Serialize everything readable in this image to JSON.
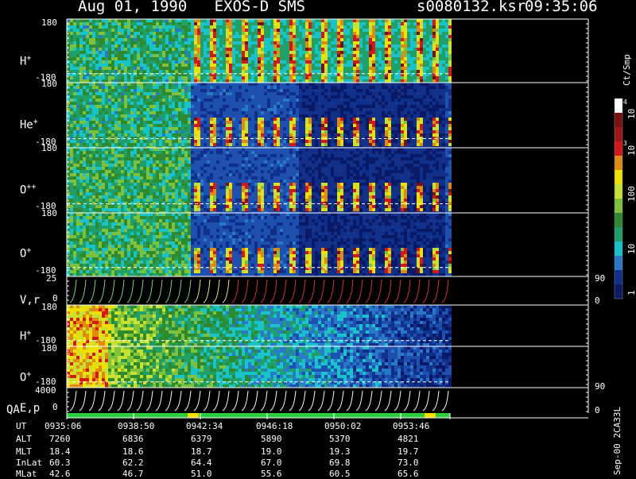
{
  "header": {
    "title": "Aug 01, 1990   EXOS-D SMS",
    "file": "s0080132.ksr",
    "time": "09:35:06"
  },
  "colorbar": {
    "unit": "Ct/Smp",
    "ticks": [
      "10",
      "10",
      "10",
      "100",
      "10",
      "1"
    ],
    "exponents": [
      "4",
      "3"
    ]
  },
  "footer_left": "Sep-00 2CA33L",
  "chart_data": {
    "type": "heatmap",
    "time_axis": {
      "label": "UT",
      "ticks": [
        "0935:06",
        "0938:50",
        "0942:34",
        "0946:18",
        "0950:02",
        "0953:46"
      ]
    },
    "ephemeris": [
      {
        "label": "ALT",
        "values": [
          "7260",
          "6836",
          "6379",
          "5890",
          "5370",
          "4821"
        ]
      },
      {
        "label": "MLT",
        "values": [
          "18.4",
          "18.6",
          "18.7",
          "19.0",
          "19.3",
          "19.7"
        ]
      },
      {
        "label": "InLat",
        "values": [
          "60.3",
          "62.2",
          "64.4",
          "67.0",
          "69.8",
          "73.0"
        ]
      },
      {
        "label": "MLat",
        "values": [
          "42.6",
          "46.7",
          "51.0",
          "55.6",
          "60.5",
          "65.6"
        ]
      }
    ],
    "panels": [
      {
        "label": "H",
        "sup": "+",
        "ymax": "180",
        "ymin": "-180"
      },
      {
        "label": "He",
        "sup": "+",
        "ymax": "180",
        "ymin": "-180"
      },
      {
        "label": "O",
        "sup": "++",
        "ymax": "180",
        "ymin": "-180"
      },
      {
        "label": "O",
        "sup": "+",
        "ymax": "180",
        "ymin": "-180"
      },
      {
        "label": "V,r",
        "sup": "",
        "ymax": "25",
        "ymin": "0",
        "right_top": "90",
        "right_bottom": "0"
      },
      {
        "label": "H",
        "sup": "+",
        "ymax": "180",
        "ymin": "-180"
      },
      {
        "label": "O",
        "sup": "+",
        "ymax": "180",
        "ymin": "-180"
      },
      {
        "label": "E,p",
        "sup": "",
        "ymax": "4000",
        "ymin": "0",
        "right_top": "90",
        "right_bottom": "0"
      }
    ],
    "qa_label": "QA",
    "colors": {
      "low": "#0a1a66",
      "mid": "#1e6fc2",
      "cyan": "#18c3c9",
      "green": "#2e8a2e",
      "yellow": "#f0e000",
      "red": "#d41818",
      "darkred": "#7a1010"
    }
  }
}
